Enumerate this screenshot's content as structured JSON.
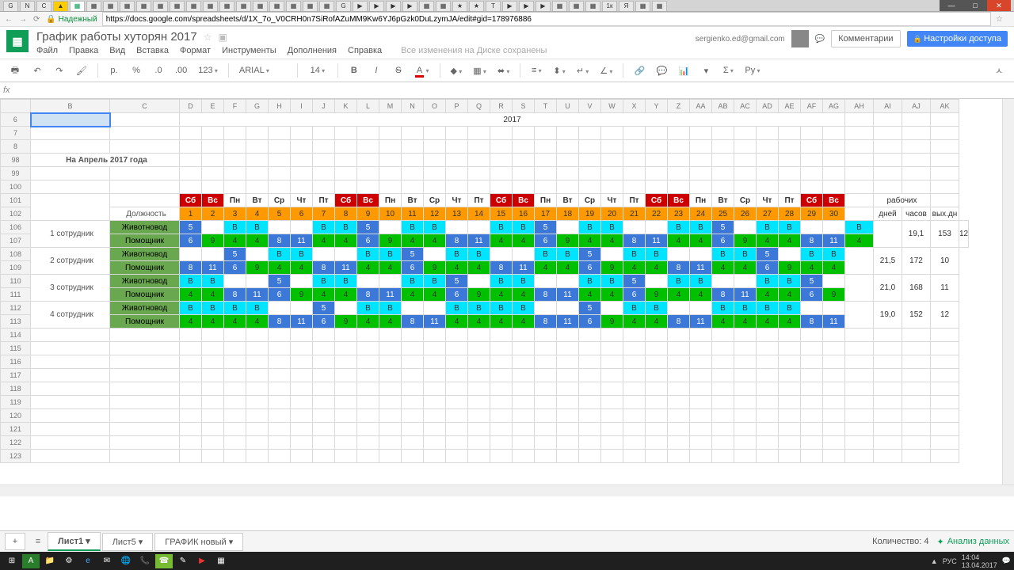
{
  "browser": {
    "url": "https://docs.google.com/spreadsheets/d/1X_7o_V0CRH0n7SiRofAZuMM9Kw6YJ6pGzk0DuLzymJA/edit#gid=178976886",
    "secure": "Надежный"
  },
  "doc": {
    "title": "График работы хуторян 2017",
    "user_email": "sergienko.ed@gmail.com",
    "saved": "Все изменения на Диске сохранены"
  },
  "menus": [
    "Файл",
    "Правка",
    "Вид",
    "Вставка",
    "Формат",
    "Инструменты",
    "Дополнения",
    "Справка"
  ],
  "buttons": {
    "comments": "Комментарии",
    "share": "Настройки доступа"
  },
  "toolbar": {
    "font": "ARIAL",
    "size": "14",
    "currency": "р.",
    "pct": "%",
    "dec1": ".0",
    "dec2": ".00",
    "num": "123",
    "bold": "B",
    "italic": "I",
    "strike": "S",
    "und": "A",
    "cyr": "Ру"
  },
  "columns": [
    "",
    "B",
    "C",
    "D",
    "E",
    "F",
    "G",
    "H",
    "I",
    "J",
    "K",
    "L",
    "M",
    "N",
    "O",
    "P",
    "Q",
    "R",
    "S",
    "T",
    "U",
    "V",
    "W",
    "X",
    "Y",
    "Z",
    "AA",
    "AB",
    "AC",
    "AD",
    "AE",
    "AF",
    "AG",
    "AH",
    "AI",
    "AJ",
    "AK"
  ],
  "rowHeaders": [
    "6",
    "7",
    "8",
    "98",
    "99",
    "100",
    "101",
    "102",
    "106",
    "107",
    "108",
    "109",
    "110",
    "111",
    "112",
    "113",
    "114",
    "115",
    "116",
    "117",
    "118",
    "119",
    "120",
    "121",
    "122",
    "123"
  ],
  "cells": {
    "year": "2017",
    "heading": "На Апрель 2017 года",
    "posLabel": "Должность",
    "pos": [
      "Животновод",
      "Помощник"
    ],
    "emp": [
      "1 сотрудник",
      "2 сотрудник",
      "3 сотрудник",
      "4 сотрудник"
    ],
    "dowRow": [
      "Сб",
      "Вс",
      "Пн",
      "Вт",
      "Ср",
      "Чт",
      "Пт",
      "Сб",
      "Вс",
      "Пн",
      "Вт",
      "Ср",
      "Чт",
      "Пт",
      "Сб",
      "Вс",
      "Пн",
      "Вт",
      "Ср",
      "Чт",
      "Пт",
      "Сб",
      "Вс",
      "Пн",
      "Вт",
      "Ср",
      "Чт",
      "Пт",
      "Сб",
      "Вс"
    ],
    "sumHead": {
      "top": "рабочих",
      "d": "дней",
      "h": "часов",
      "off": "вых.дн"
    },
    "e1": {
      "r1": [
        "5",
        "",
        "В",
        "В",
        "",
        "",
        "В",
        "В",
        "5",
        "",
        "В",
        "В",
        "",
        "",
        "В",
        "В",
        "5",
        "",
        "В",
        "В",
        "",
        "",
        "В",
        "В",
        "5",
        "",
        "В",
        "В",
        "",
        "",
        "В"
      ],
      "r2": [
        "6",
        "9",
        "4",
        "4",
        "8",
        "11",
        "4",
        "4",
        "6",
        "9",
        "4",
        "4",
        "8",
        "11",
        "4",
        "4",
        "6",
        "9",
        "4",
        "4",
        "8",
        "11",
        "4",
        "4",
        "6",
        "9",
        "4",
        "4",
        "8",
        "11",
        "4"
      ],
      "d": "19,1",
      "h": "153",
      "o": "12"
    },
    "e2": {
      "r1": [
        "",
        "",
        "5",
        "",
        "В",
        "В",
        "",
        "",
        "В",
        "В",
        "5",
        "",
        "В",
        "В",
        "",
        "",
        "В",
        "В",
        "5",
        "",
        "В",
        "В",
        "",
        "",
        "В",
        "В",
        "5",
        "",
        "В",
        "В"
      ],
      "r2": [
        "8",
        "11",
        "6",
        "9",
        "4",
        "4",
        "8",
        "11",
        "4",
        "4",
        "6",
        "9",
        "4",
        "4",
        "8",
        "11",
        "4",
        "4",
        "6",
        "9",
        "4",
        "4",
        "8",
        "11",
        "4",
        "4",
        "6",
        "9",
        "4",
        "4"
      ],
      "d": "21,5",
      "h": "172",
      "o": "10"
    },
    "e3": {
      "r1": [
        "В",
        "В",
        "",
        "",
        "5",
        "",
        "В",
        "В",
        "",
        "",
        "В",
        "В",
        "5",
        "",
        "В",
        "В",
        "",
        "",
        "В",
        "В",
        "5",
        "",
        "В",
        "В",
        "",
        "",
        "В",
        "В",
        "5",
        ""
      ],
      "r2": [
        "4",
        "4",
        "8",
        "11",
        "6",
        "9",
        "4",
        "4",
        "8",
        "11",
        "4",
        "4",
        "6",
        "9",
        "4",
        "4",
        "8",
        "11",
        "4",
        "4",
        "6",
        "9",
        "4",
        "4",
        "8",
        "11",
        "4",
        "4",
        "6",
        "9"
      ],
      "d": "21,0",
      "h": "168",
      "o": "11"
    },
    "e4": {
      "r1": [
        "В",
        "В",
        "В",
        "В",
        "",
        "",
        "5",
        "",
        "В",
        "В",
        "",
        "",
        "В",
        "В",
        "В",
        "В",
        "",
        "",
        "5",
        "",
        "В",
        "В",
        "",
        "",
        "В",
        "В",
        "В",
        "В",
        "",
        ""
      ],
      "r2": [
        "4",
        "4",
        "4",
        "4",
        "8",
        "11",
        "6",
        "9",
        "4",
        "4",
        "8",
        "11",
        "4",
        "4",
        "4",
        "4",
        "8",
        "11",
        "6",
        "9",
        "4",
        "4",
        "8",
        "11",
        "4",
        "4",
        "4",
        "4",
        "8",
        "11"
      ],
      "d": "19,0",
      "h": "152",
      "o": "12"
    }
  },
  "weekend": [
    0,
    1,
    7,
    8,
    14,
    15,
    21,
    22,
    28,
    29
  ],
  "dayCount": 30,
  "footer": {
    "tabs": [
      "Лист1",
      "Лист5",
      "ГРАФИК новый"
    ],
    "count": "Количество: 4",
    "analyze": "Анализ данных"
  },
  "tray": {
    "lang": "РУС",
    "time": "14:04",
    "date": "13.04.2017"
  }
}
